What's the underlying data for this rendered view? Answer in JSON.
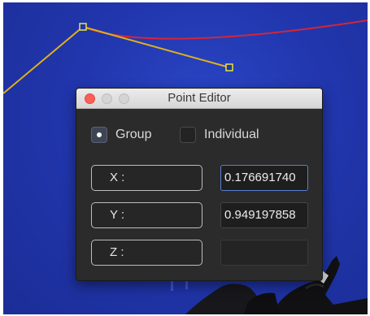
{
  "window": {
    "title": "Point Editor"
  },
  "mode": {
    "options": [
      {
        "label": "Group",
        "selected": true
      },
      {
        "label": "Individual",
        "selected": false
      }
    ]
  },
  "fields": {
    "x": {
      "label": "X :",
      "value": "0.176691740"
    },
    "y": {
      "label": "Y :",
      "value": "0.949197858"
    },
    "z": {
      "label": "Z :",
      "value": ""
    }
  },
  "colors": {
    "viewport_background": "#2136ad",
    "spline_yellow": "#e0b01c",
    "spline_red": "#d3263a",
    "control_point": "#e7e53a"
  }
}
